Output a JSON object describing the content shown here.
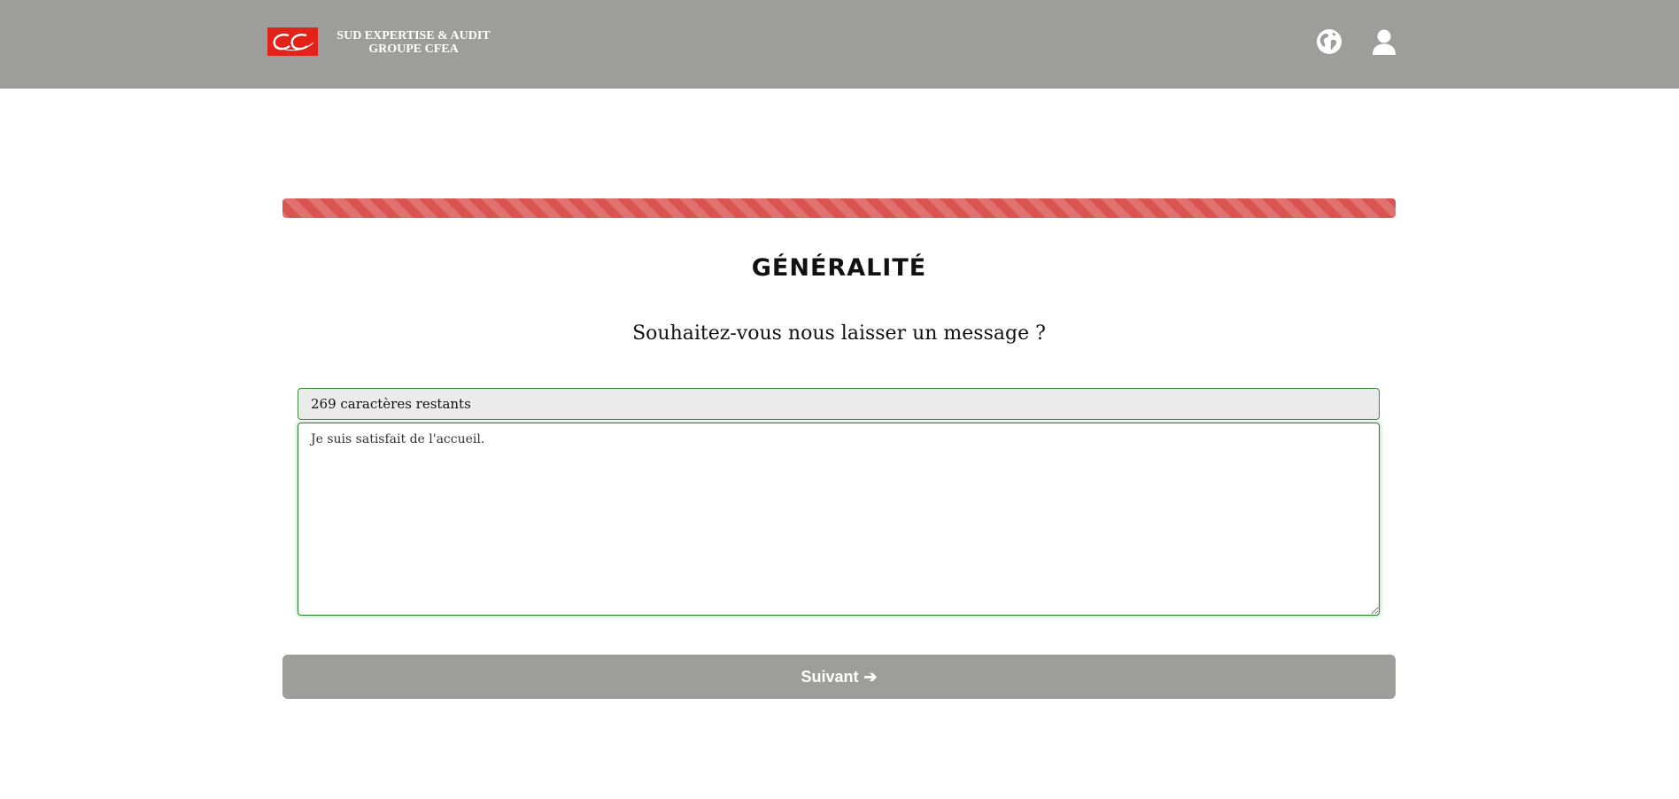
{
  "header": {
    "brand_line1": "SUD EXPERTISE & AUDIT",
    "brand_line2": "GROUPE CFEA",
    "logo_color": "#e2231a",
    "background": "#9d9d9c",
    "icons": [
      "globe-icon",
      "user-icon"
    ]
  },
  "progress": {
    "color": "#d9534f",
    "value_percent": 100
  },
  "section": {
    "title": "GÉNÉRALITÉ",
    "question": "Souhaitez-vous nous laisser un message ?"
  },
  "form": {
    "counter_text": "269 caractères restants",
    "message_value": "Je suis satisfait de l'accueil."
  },
  "actions": {
    "next_label": "Suivant",
    "next_icon": "arrow-right-icon",
    "button_color": "#9d9d9c"
  }
}
